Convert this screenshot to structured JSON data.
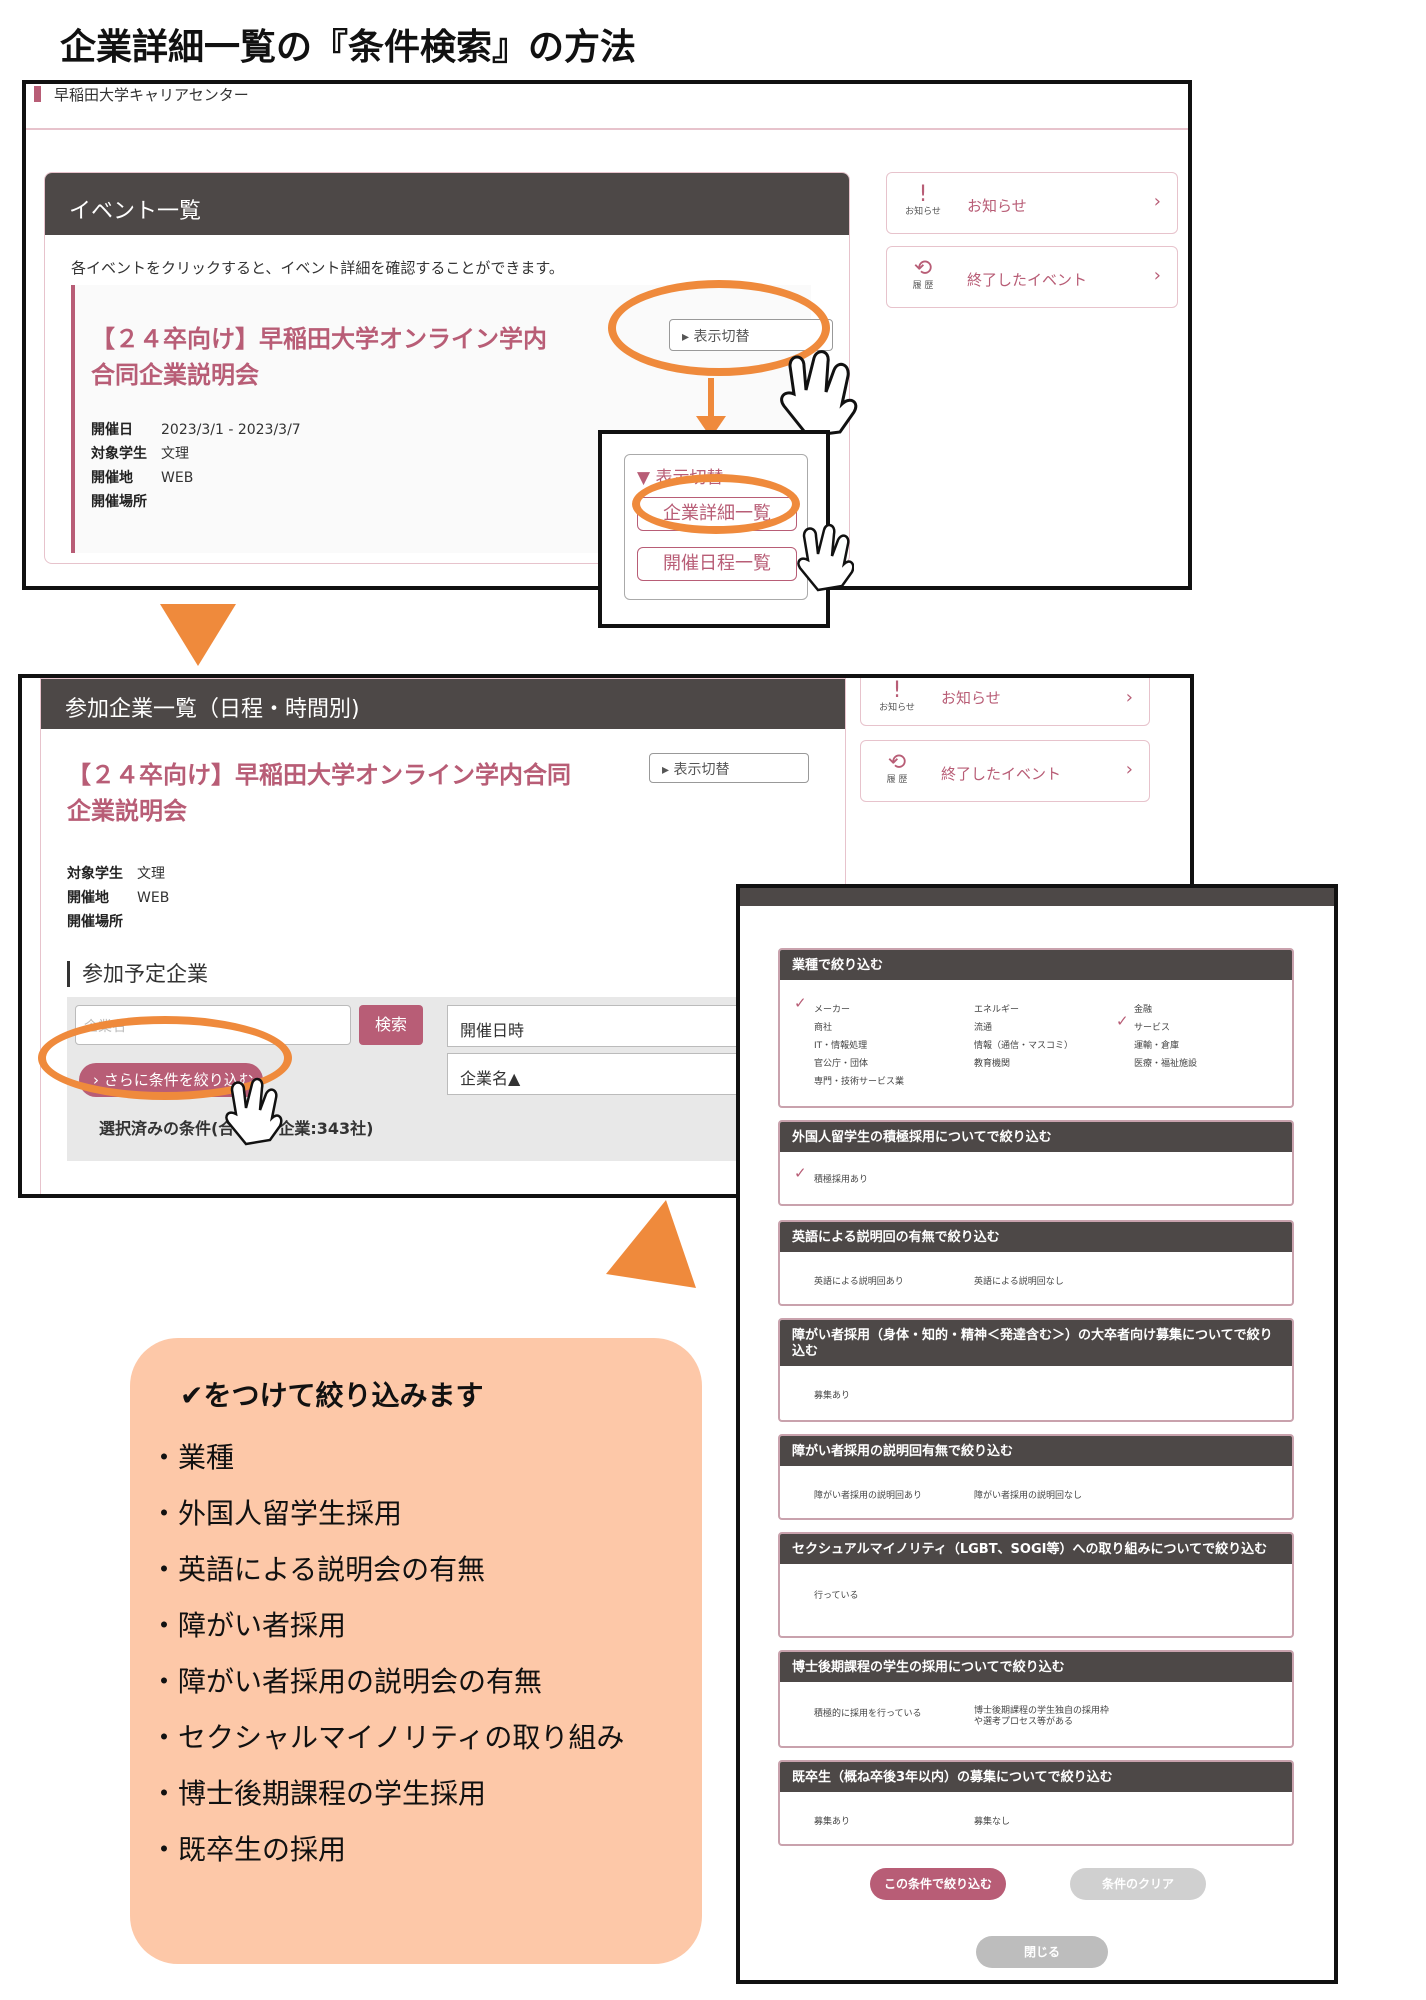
{
  "page_title": "企業詳細一覧の『条件検索』の方法",
  "shot1": {
    "site_name": "早稲田大学キャリアセンター",
    "panel_title": "イベント一覧",
    "description": "各イベントをクリックすると、イベント詳細を確認することができます。",
    "event": {
      "title_line1": "【２４卒向け】早稲田大学オンライン学内",
      "title_line2": "合同企業説明会",
      "date_label": "開催日",
      "date_value": "2023/3/1 - 2023/3/7",
      "target_label": "対象学生",
      "target_value": "文理",
      "place_label": "開催地",
      "place_value": "WEB",
      "venue_label": "開催場所"
    },
    "toggle_label": "▸ 表示切替",
    "sidebar": {
      "news_icon_caption": "お知らせ",
      "news_label": "お知らせ",
      "ended_icon_caption": "履 歴",
      "ended_label": "終了したイベント",
      "chevron": "›"
    },
    "dropdown": {
      "header": "▼ 表示切替",
      "item1": "企業詳細一覧",
      "item2": "開催日程一覧"
    }
  },
  "shot2": {
    "panel_title": "参加企業一覧（日程・時間別)",
    "event_title_line1": "【２４卒向け】早稲田大学オンライン学内合同",
    "event_title_line2": "企業説明会",
    "toggle_label": "▸ 表示切替",
    "target_label": "対象学生",
    "target_value": "文理",
    "place_label": "開催地",
    "place_value": "WEB",
    "venue_label": "開催場所",
    "section_heading": "参加予定企業",
    "search_placeholder": "企業名",
    "search_button": "検索",
    "select_date": "開催日時",
    "select_sort": "企業名▲",
    "refine_button": "› さらに条件を絞り込む",
    "selected_conditions": "選択済みの条件(合",
    "selected_conditions_tail": "企業:343社)",
    "sidebar": {
      "news_icon_caption": "お知らせ",
      "news_label": "お知らせ",
      "ended_icon_caption": "履 歴",
      "ended_label": "終了したイベント",
      "chevron": "›"
    }
  },
  "modal": {
    "groups": [
      {
        "title": "業種で絞り込む",
        "options": [
          "メーカー",
          "エネルギー",
          "金融",
          "商社",
          "流通",
          "サービス",
          "IT・情報処理",
          "情報（通信・マスコミ）",
          "運輸・倉庫",
          "官公庁・団体",
          "教育機関",
          "医療・福祉施設",
          "専門・技術サービス業"
        ]
      },
      {
        "title": "外国人留学生の積極採用についてで絞り込む",
        "options": [
          "積極採用あり"
        ]
      },
      {
        "title": "英語による説明回の有無で絞り込む",
        "options": [
          "英語による説明回あり",
          "英語による説明回なし"
        ]
      },
      {
        "title": "障がい者採用（身体・知的・精神＜発達含む＞）の大卒者向け募集についてで絞り込む",
        "options": [
          "募集あり"
        ]
      },
      {
        "title": "障がい者採用の説明回有無で絞り込む",
        "options": [
          "障がい者採用の説明回あり",
          "障がい者採用の説明回なし"
        ]
      },
      {
        "title": "セクシュアルマイノリティ（LGBT、SOGI等）への取り組みについてで絞り込む",
        "options": [
          "行っている"
        ]
      },
      {
        "title": "博士後期課程の学生の採用についてで絞り込む",
        "options": [
          "積極的に採用を行っている",
          "博士後期課程の学生独自の採用枠や選考プロセス等がある"
        ]
      },
      {
        "title": "既卒生（概ね卒後3年以内）の募集についてで絞り込む",
        "options": [
          "募集あり",
          "募集なし"
        ]
      }
    ],
    "apply_button": "この条件で絞り込む",
    "clear_button": "条件のクリア",
    "close_button": "閉じる",
    "checkmark": "✓"
  },
  "note": {
    "heading": "✔をつけて絞り込みます",
    "items": [
      "・業種",
      "・外国人留学生採用",
      "・英語による説明会の有無",
      "・障がい者採用",
      "・障がい者採用の説明会の有無",
      "・セクシャルマイノリティの取り組み",
      "・博士後期課程の学生採用",
      "・既卒生の採用"
    ]
  },
  "colors": {
    "accent": "#b85d76",
    "orange": "#ef8a3c",
    "dark_header": "#4d4847",
    "note_bg": "#fdc8a8"
  }
}
